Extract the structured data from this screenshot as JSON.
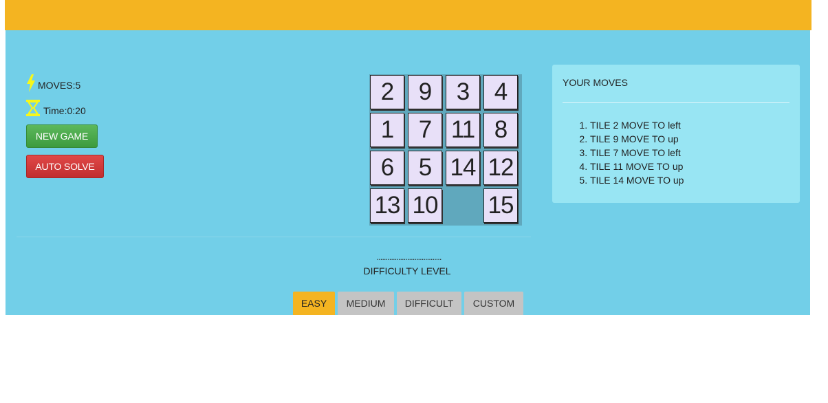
{
  "stats": {
    "moves_label": "MOVES:5",
    "time_label": "Time:0:20",
    "moves_icon": "lightning-icon",
    "time_icon": "hourglass-icon",
    "icon_color": "#f7f71a"
  },
  "buttons": {
    "new_game": "NEW GAME",
    "auto_solve": "AUTO SOLVE"
  },
  "board": {
    "rows": 4,
    "cols": 4,
    "tiles": [
      [
        "2",
        "9",
        "3",
        "4"
      ],
      [
        "1",
        "7",
        "11",
        "8"
      ],
      [
        "6",
        "5",
        "14",
        "12"
      ],
      [
        "13",
        "10",
        "",
        "15"
      ]
    ]
  },
  "difficulty": {
    "dots": "....................................",
    "label": "DIFFICULTY LEVEL",
    "levels": [
      "EASY",
      "MEDIUM",
      "DIFFICULT",
      "CUSTOM"
    ],
    "selected": "EASY"
  },
  "moves_panel": {
    "title": "YOUR MOVES",
    "moves": [
      "TILE 2 MOVE TO left",
      "TILE 9 MOVE TO up",
      "TILE 7 MOVE TO left",
      "TILE 11 MOVE TO up",
      "TILE 14 MOVE TO up"
    ]
  },
  "colors": {
    "header": "#f4b421",
    "background": "#72cfe8",
    "panel": "#98e5f3",
    "tile": "#e8e0f8",
    "empty_slot": "#60a8bd",
    "new_game": "#4aa94a",
    "auto_solve": "#d03b3b",
    "active_level": "#f4b421",
    "inactive_level": "#c4c4c4"
  }
}
